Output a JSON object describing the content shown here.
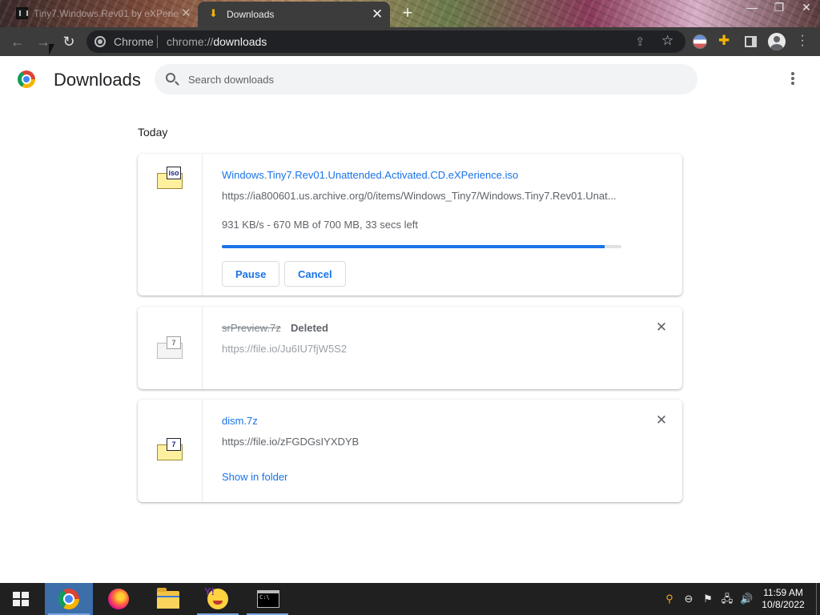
{
  "window": {
    "tabs": [
      {
        "label": "Tiny7.Windows.Rev01 by eXPerie",
        "active": false
      },
      {
        "label": "Downloads",
        "active": true
      }
    ],
    "new_tab_glyph": "+",
    "controls": [
      "—",
      "❐",
      "✕"
    ]
  },
  "toolbar": {
    "back_icon": "←",
    "forward_icon": "→",
    "reload_icon": "↻",
    "omnibox": {
      "site_label": "Chrome",
      "url_prefix": "chrome://",
      "url_path": "downloads"
    }
  },
  "page": {
    "title": "Downloads",
    "search": {
      "placeholder": "Search downloads",
      "value": ""
    },
    "section_label": "Today"
  },
  "downloads": [
    {
      "file_name": "Windows.Tiny7.Rev01.Unattended.Activated.CD.eXPerience.iso",
      "url": "https://ia800601.us.archive.org/0/items/Windows_Tiny7/Windows.Tiny7.Rev01.Unat...",
      "status_text": "931 KB/s - 670 MB of 700 MB, 33 secs left",
      "progress": 0.957,
      "icon_badge": "iso",
      "pause_label": "Pause",
      "cancel_label": "Cancel"
    },
    {
      "file_name": "srPreview.7z",
      "status_tag": "Deleted",
      "url": "https://file.io/Ju6IU7fjW5S2",
      "icon_badge": "7"
    },
    {
      "file_name": "dism.7z",
      "url": "https://file.io/zFGDGsIYXDYB",
      "icon_badge": "7",
      "show_in_folder_label": "Show in folder"
    }
  ],
  "taskbar": {
    "clock_time": "11:59 AM",
    "clock_date": "10/8/2022"
  },
  "icons": {
    "close": "✕",
    "share": "⇪",
    "star": "☆",
    "puzzle": "✚",
    "search": "search-icon",
    "volume": "🔊"
  },
  "colors": {
    "accent": "#1a73e8",
    "toolbar_bg": "#3c3c3c",
    "taskbar_bg": "#202020",
    "taskbar_active": "#3c6eaa"
  }
}
